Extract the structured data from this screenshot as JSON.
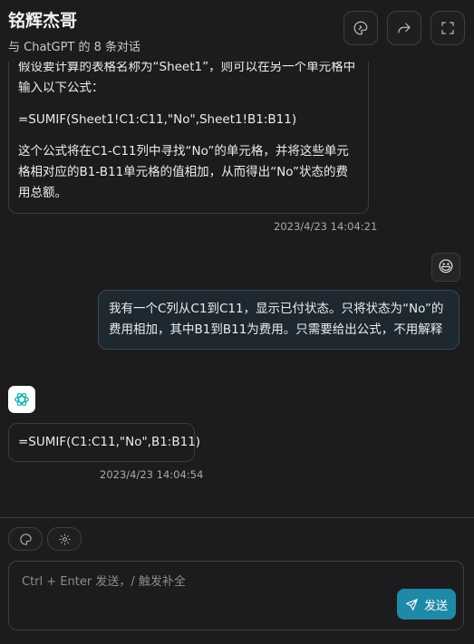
{
  "header": {
    "title": "铭辉杰哥",
    "subtitle": "与 ChatGPT 的 8 条对话"
  },
  "messages": {
    "m1": {
      "role": "assistant",
      "lines": [
        "假设要计算的表格名称为“Sheet1”，则可以在另一个单元格中输入以下公式：",
        "=SUMIF(Sheet1!C1:C11,\"No\",Sheet1!B1:B11)",
        "这个公式将在C1-C11列中寻找“No”的单元格，并将这些单元格相对应的B1-B11单元格的值相加，从而得出“No”状态的费用总额。"
      ],
      "timestamp": "2023/4/23 14:04:21"
    },
    "m2": {
      "role": "user",
      "avatar": "😃",
      "text": "我有一个C列从C1到C11，显示已付状态。只将状态为“No”的费用相加，其中B1到B11为费用。只需要给出公式，不用解释"
    },
    "m3": {
      "role": "assistant",
      "text": "=SUMIF(C1:C11,\"No\",B1:B11)",
      "timestamp": "2023/4/23 14:04:54"
    }
  },
  "input": {
    "placeholder": "Ctrl + Enter 发送，/ 触发补全",
    "value": "",
    "send_label": "发送"
  },
  "icons": {
    "brand_color": "#1f8aa8",
    "user_bubble_color": "#1d2830"
  }
}
